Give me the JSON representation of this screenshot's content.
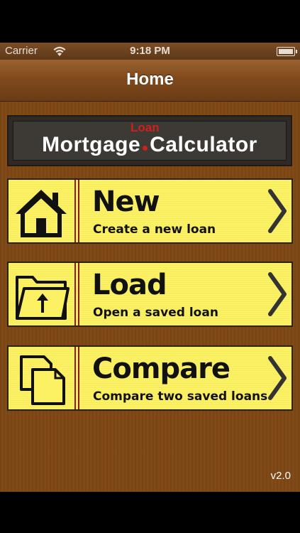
{
  "status_bar": {
    "carrier": "Carrier",
    "time": "9:18 PM"
  },
  "nav": {
    "title": "Home"
  },
  "logo": {
    "word1": "Mortgage",
    "superscript": "Loan",
    "word2": "Calculator",
    "accent_color": "#d0201a"
  },
  "menu": [
    {
      "title": "New",
      "subtitle": "Create a new loan",
      "icon": "house-icon"
    },
    {
      "title": "Load",
      "subtitle": "Open a saved loan",
      "icon": "folder-upload-icon"
    },
    {
      "title": "Compare",
      "subtitle": "Compare two saved loans",
      "icon": "copy-documents-icon"
    }
  ],
  "version": "v2.0",
  "colors": {
    "button_bg": "#fbf163",
    "divider": "#8a1e14",
    "background": "#7e4714",
    "navbar": "#804a1d"
  }
}
